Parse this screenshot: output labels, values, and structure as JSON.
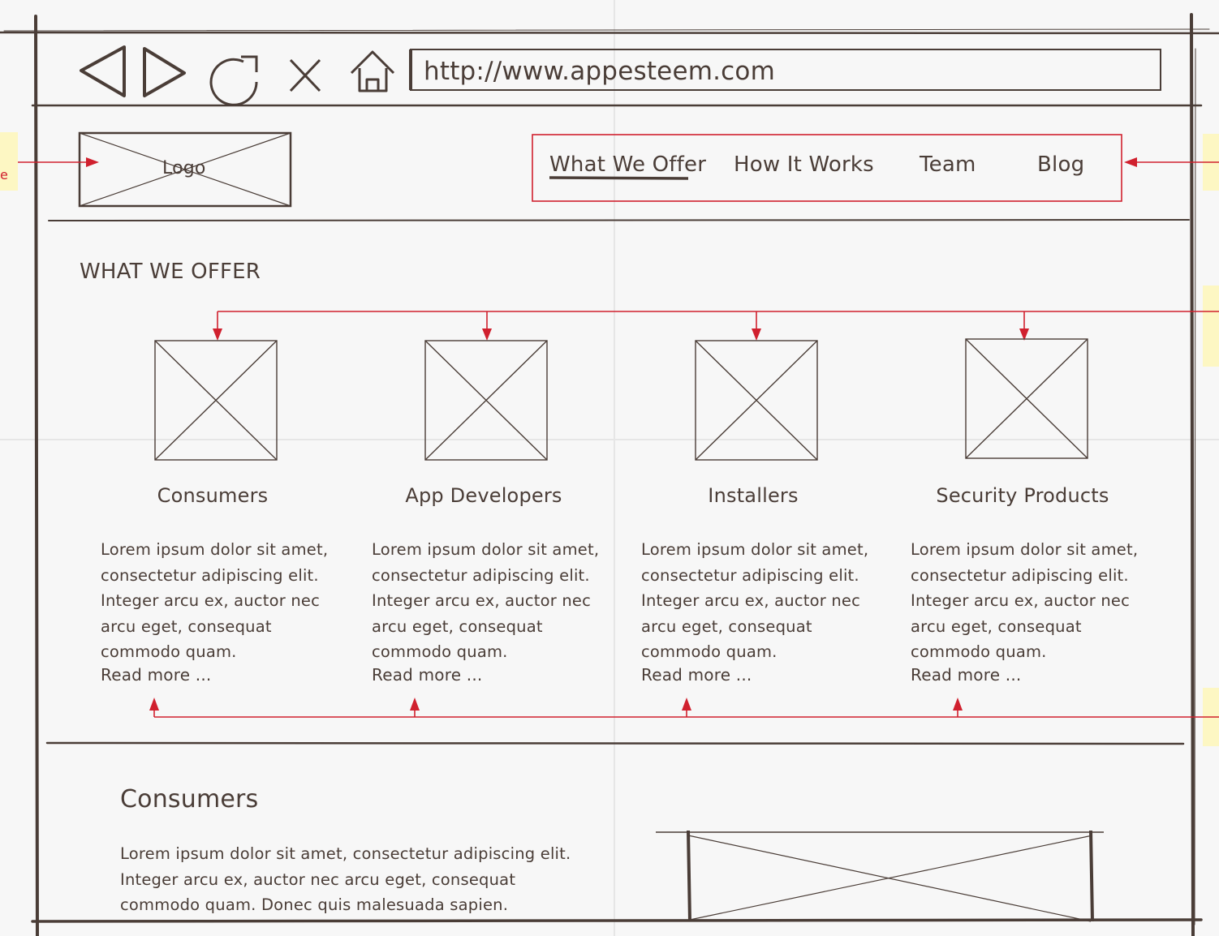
{
  "browser": {
    "url": "http://www.appesteem.com",
    "icons": [
      "back-icon",
      "forward-icon",
      "refresh-icon",
      "close-icon",
      "home-icon"
    ]
  },
  "header": {
    "logo_label": "Logo",
    "nav": [
      "What We Offer",
      "How It Works",
      "Team",
      "Blog"
    ],
    "active_nav": "What We Offer"
  },
  "section": {
    "heading": "WHAT WE OFFER",
    "cards": [
      {
        "title": "Consumers",
        "body": "Lorem ipsum dolor sit amet, consectetur adipiscing elit. Integer arcu ex, auctor nec arcu eget, consequat commodo quam.",
        "link": "Read more ..."
      },
      {
        "title": "App Developers",
        "body": "Lorem ipsum dolor sit amet, consectetur adipiscing elit. Integer arcu ex, auctor nec arcu eget, consequat commodo quam.",
        "link": "Read more ..."
      },
      {
        "title": "Installers",
        "body": "Lorem ipsum dolor sit amet, consectetur adipiscing elit. Integer arcu ex, auctor nec arcu eget, consequat commodo quam.",
        "link": "Read more ..."
      },
      {
        "title": "Security Products",
        "body": "Lorem ipsum dolor sit amet, consectetur adipiscing elit. Integer arcu ex, auctor nec arcu eget, consequat commodo quam.",
        "link": "Read more ..."
      }
    ]
  },
  "detail": {
    "title": "Consumers",
    "body": "Lorem ipsum dolor sit amet, consectetur adipiscing elit. Integer arcu ex, auctor nec arcu eget, consequat commodo quam. Donec quis malesuada sapien."
  },
  "annotations": {
    "left_fragment": "e"
  },
  "colors": {
    "ink": "#4a3d37",
    "annotation": "#d0202e",
    "note": "#fdf7c3",
    "paper": "#f7f7f7"
  }
}
